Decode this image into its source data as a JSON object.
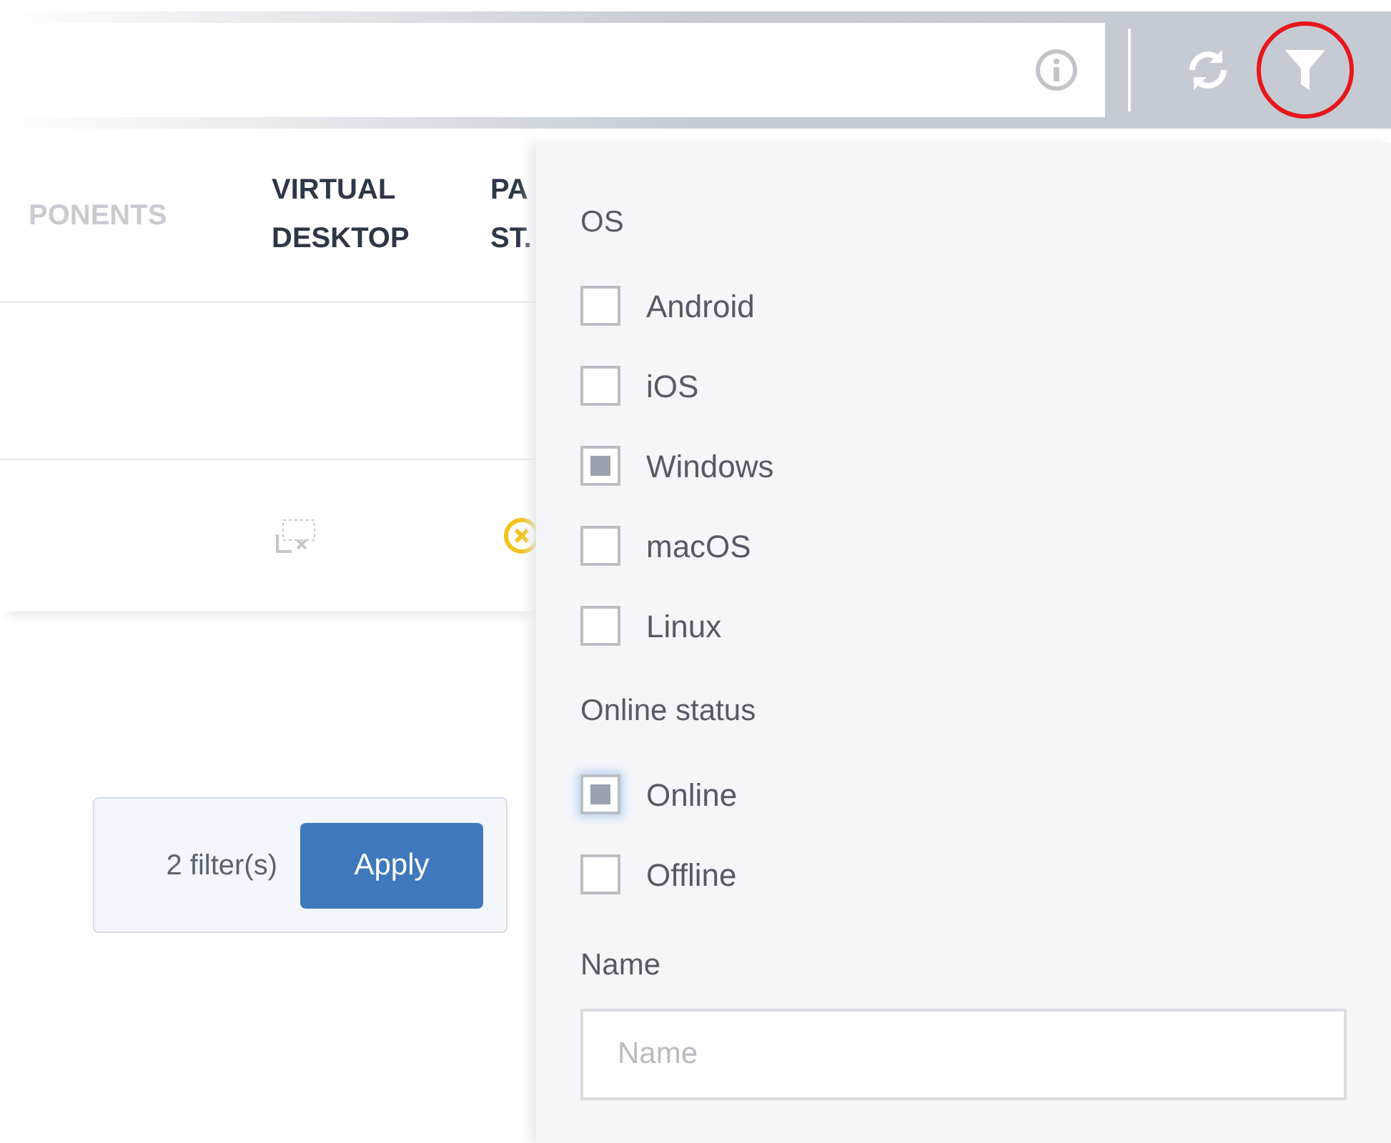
{
  "table": {
    "columns": [
      "PONENTS",
      "VIRTUAL DESKTOP",
      "PA ST."
    ]
  },
  "filter_count": {
    "text": "2 filter(s)",
    "button": "Apply"
  },
  "filter_panel": {
    "sections": [
      {
        "title": "OS",
        "options": [
          {
            "label": "Android",
            "checked": false
          },
          {
            "label": "iOS",
            "checked": false
          },
          {
            "label": "Windows",
            "checked": true
          },
          {
            "label": "macOS",
            "checked": false
          },
          {
            "label": "Linux",
            "checked": false
          }
        ]
      },
      {
        "title": "Online status",
        "options": [
          {
            "label": "Online",
            "checked": true,
            "focused": true
          },
          {
            "label": "Offline",
            "checked": false,
            "focused": false
          }
        ]
      }
    ],
    "name_field": {
      "label": "Name",
      "placeholder": "Name"
    }
  }
}
